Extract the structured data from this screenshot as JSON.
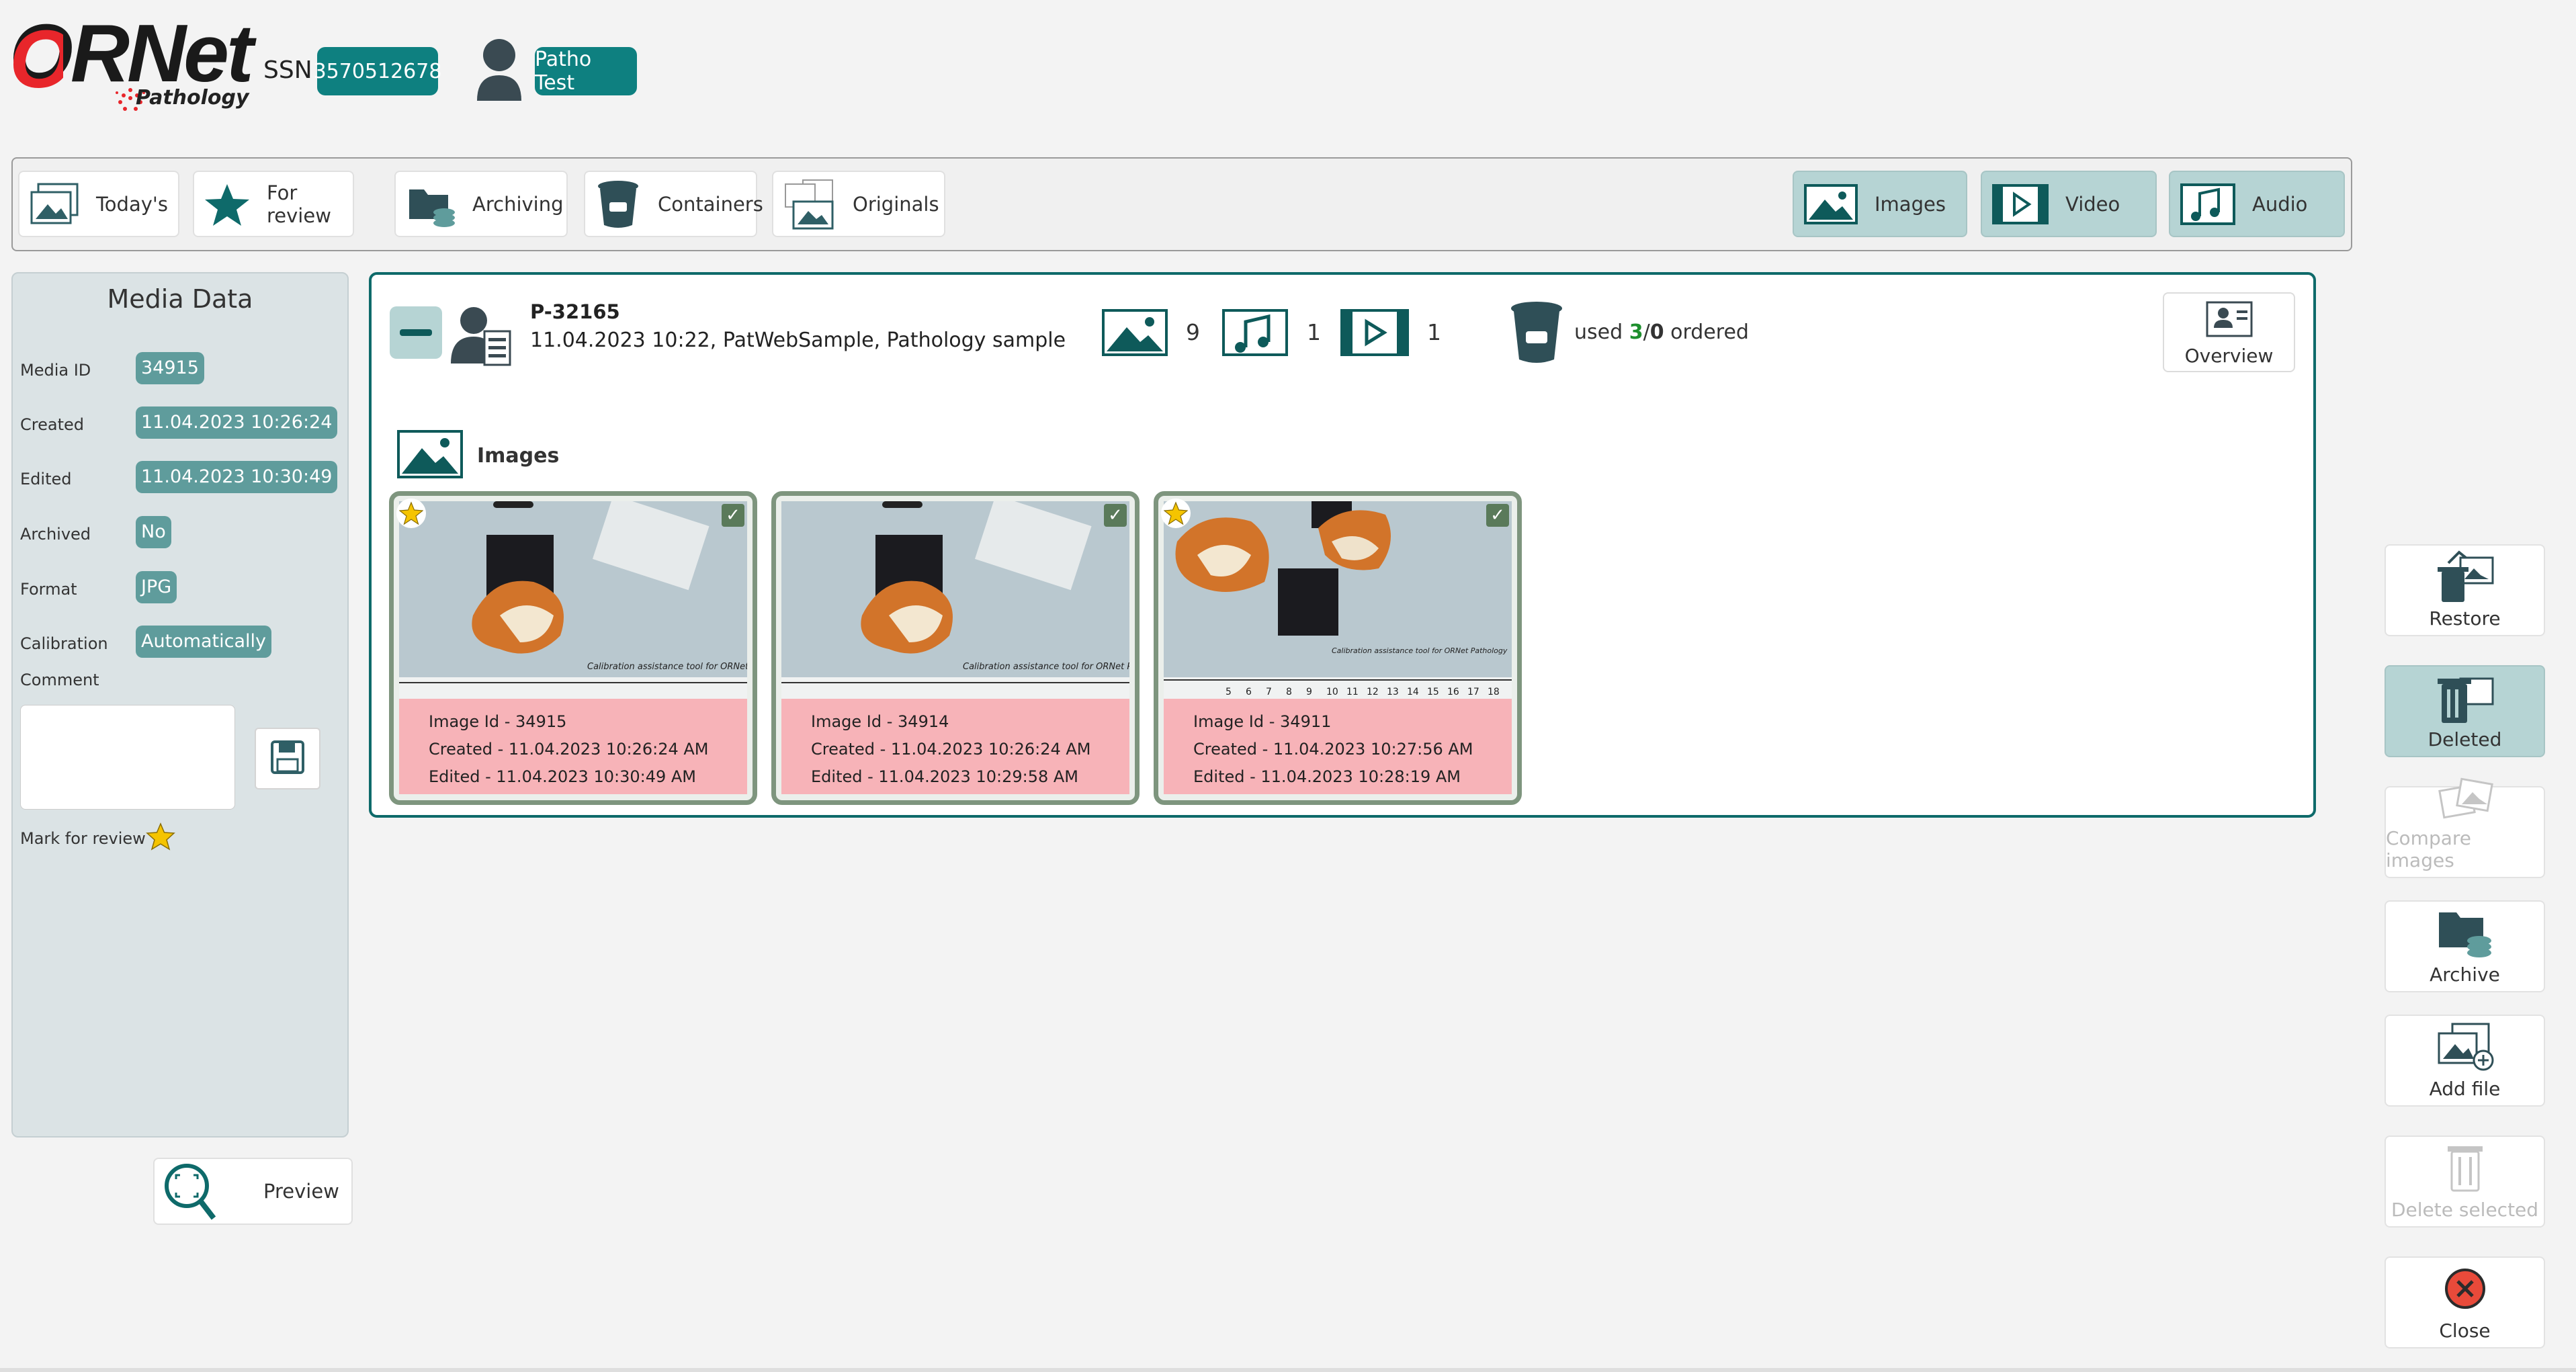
{
  "header": {
    "logo_text": "ORNet",
    "logo_sub": "Pathology",
    "ssn_label": "SSN",
    "ssn_value": "3570512678",
    "patient_name": "Patho Test"
  },
  "toolbar": {
    "todays": "Today's",
    "for_review": "For review",
    "archiving": "Archiving",
    "containers": "Containers",
    "originals": "Originals",
    "images": "Images",
    "video": "Video",
    "audio": "Audio"
  },
  "media_data": {
    "title": "Media Data",
    "media_id_label": "Media ID",
    "media_id": "34915",
    "created_label": "Created",
    "created": "11.04.2023 10:26:24",
    "edited_label": "Edited",
    "edited": "11.04.2023 10:30:49",
    "archived_label": "Archived",
    "archived": "No",
    "format_label": "Format",
    "format": "JPG",
    "calibration_label": "Calibration",
    "calibration": "Automatically",
    "comment_label": "Comment",
    "comment": "",
    "mark_for_review_label": "Mark for review"
  },
  "preview_label": "Preview",
  "case": {
    "id": "P-32165",
    "description": "11.04.2023 10:22, PatWebSample, Pathology sample",
    "image_count": "9",
    "audio_count": "1",
    "video_count": "1",
    "used_label": "used",
    "used": "3",
    "separator": "/",
    "ordered": "0",
    "ordered_label": "ordered",
    "overview_label": "Overview",
    "section_title": "Images"
  },
  "images": [
    {
      "id": "Image Id - 34915",
      "created": "Created - 11.04.2023 10:26:24 AM",
      "edited": "Edited - 11.04.2023 10:30:49 AM",
      "starred": true,
      "checked": true
    },
    {
      "id": "Image Id - 34914",
      "created": "Created - 11.04.2023 10:26:24 AM",
      "edited": "Edited - 11.04.2023 10:29:58 AM",
      "starred": false,
      "checked": true
    },
    {
      "id": "Image Id - 34911",
      "created": "Created - 11.04.2023 10:27:56 AM",
      "edited": "Edited - 11.04.2023 10:28:19 AM",
      "starred": true,
      "checked": true
    }
  ],
  "ruler_caption": "Calibration assistance tool for ORNet Pathology",
  "ruler_numbers": [
    "5",
    "6",
    "7",
    "8",
    "9",
    "10",
    "11",
    "12",
    "13",
    "14",
    "15",
    "16",
    "17",
    "18"
  ],
  "right_actions": {
    "restore": "Restore",
    "deleted": "Deleted",
    "compare": "Compare images",
    "archive": "Archive",
    "add_file": "Add file",
    "delete_selected": "Delete selected",
    "close": "Close"
  },
  "colors": {
    "accent": "#0e8080",
    "panel_border": "#0e6a6a",
    "info_bg": "#f7b3b8",
    "star": "#f5c400",
    "close_red": "#e84a3a"
  }
}
